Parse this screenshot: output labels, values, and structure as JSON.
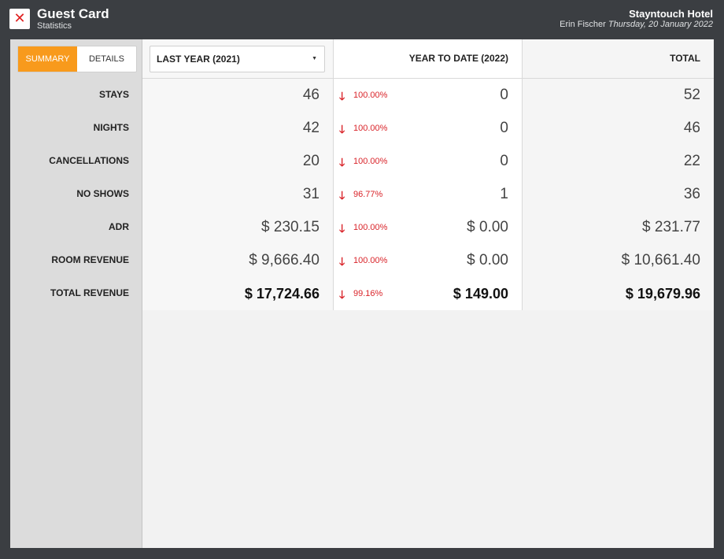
{
  "header": {
    "title": "Guest Card",
    "subtitle": "Statistics",
    "hotel": "Stayntouch Hotel",
    "user": "Erin Fischer",
    "date": "Thursday, 20 January 2022"
  },
  "toggle": {
    "summary": "SUMMARY",
    "details": "DETAILS",
    "active": "summary"
  },
  "columns": {
    "last_year": "LAST YEAR (2021)",
    "ytd": "YEAR TO DATE (2022)",
    "total": "TOTAL"
  },
  "rows": [
    {
      "label": "STAYS",
      "last_year": "46",
      "change": "100.00%",
      "direction": "down",
      "ytd": "0",
      "total": "52"
    },
    {
      "label": "NIGHTS",
      "last_year": "42",
      "change": "100.00%",
      "direction": "down",
      "ytd": "0",
      "total": "46"
    },
    {
      "label": "CANCELLATIONS",
      "last_year": "20",
      "change": "100.00%",
      "direction": "down",
      "ytd": "0",
      "total": "22"
    },
    {
      "label": "NO SHOWS",
      "last_year": "31",
      "change": "96.77%",
      "direction": "down",
      "ytd": "1",
      "total": "36"
    },
    {
      "label": "ADR",
      "last_year": "$ 230.15",
      "change": "100.00%",
      "direction": "down",
      "ytd": "$ 0.00",
      "total": "$ 231.77"
    },
    {
      "label": "ROOM REVENUE",
      "last_year": "$ 9,666.40",
      "change": "100.00%",
      "direction": "down",
      "ytd": "$ 0.00",
      "total": "$ 10,661.40"
    },
    {
      "label": "TOTAL REVENUE",
      "last_year": "$ 17,724.66",
      "change": "99.16%",
      "direction": "down",
      "ytd": "$ 149.00",
      "total": "$ 19,679.96",
      "bold": true
    }
  ],
  "colors": {
    "accent": "#f89a1c",
    "negative": "#d9242a",
    "chrome": "#3b3e42"
  },
  "icons": {
    "close": "close-icon",
    "change": "arrow-down-icon",
    "dropdown": "caret-down-icon"
  }
}
